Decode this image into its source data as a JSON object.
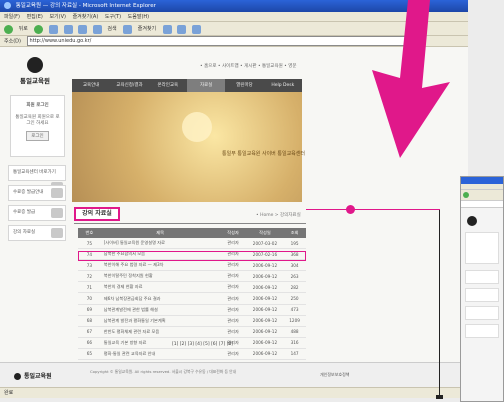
{
  "browser": {
    "title": "통일교육원 — 강의 자료실 - Microsoft Internet Explorer",
    "menu": [
      "파일(F)",
      "편집(E)",
      "보기(V)",
      "즐겨찾기(A)",
      "도구(T)",
      "도움말(H)"
    ],
    "toolbar": [
      "뒤로",
      "검색",
      "즐겨찾기"
    ],
    "address_label": "주소(D)",
    "address_value": "http://www.uniedu.go.kr/",
    "go_label": "이동",
    "status_text": "완료"
  },
  "site": {
    "logo_name": "통일교육원",
    "util_nav": "• 홈으로 • 사이트맵 • 게시판 • 통일교육원 • 영문",
    "gnb": [
      "교육안내",
      "교육신청/결과",
      "온라인교육",
      "자료실",
      "열린마당",
      "Help Desk"
    ],
    "login": {
      "title": "회원 로그인",
      "notice": "통일교육원 회원으로 로그인 하세요",
      "button": "로그인"
    },
    "banner_text": "통일부 통일교육원 사이버 통일교육센터",
    "side_items": [
      "통일교육센터 바로가기",
      "수료증 발급안내",
      "수료증 발급",
      "강의 자료실"
    ]
  },
  "board": {
    "title": "강의 자료실",
    "breadcrumb": "• Home > 강의자료실",
    "columns": [
      "번호",
      "제목",
      "작성자",
      "작성일",
      "조회"
    ],
    "rows": [
      [
        "75",
        "[사이버] 통일교육원 운영설명 자료",
        "관리자",
        "2007-03-02",
        "195"
      ],
      [
        "74",
        "남북한 주요합의서 모음",
        "관리자",
        "2007-02-16",
        "368"
      ],
      [
        "73",
        "북한이해 주요 법령 자료 — 제3차",
        "관리자",
        "2006-09-12",
        "304"
      ],
      [
        "72",
        "북한이탈주민 정착지원 현황",
        "관리자",
        "2006-09-12",
        "263"
      ],
      [
        "71",
        "북한의 경제 현황 자료",
        "관리자",
        "2006-09-12",
        "282"
      ],
      [
        "70",
        "제6차 남북장관급회담 주요 결과",
        "관리자",
        "2006-09-12",
        "250"
      ],
      [
        "69",
        "남북관계발전에 관한 법률 해설",
        "관리자",
        "2006-09-12",
        "473"
      ],
      [
        "68",
        "남북관계 발전과 평화통일 기본계획",
        "관리자",
        "2006-09-12",
        "1209"
      ],
      [
        "67",
        "한반도 평화체제 관련 자료 모음",
        "관리자",
        "2006-09-12",
        "488"
      ],
      [
        "66",
        "통일교육 기본 방향 자료",
        "관리자",
        "2006-09-12",
        "316"
      ],
      [
        "65",
        "평화·통일 관련 교육자료 안내",
        "관리자",
        "2006-09-12",
        "147"
      ],
      [
        "64",
        "통일문제 이해 강의자료",
        "관리자",
        "2006-09-12",
        "265"
      ]
    ],
    "pager": "[1] [2] [3] [4] [5] [6] [7] [8]"
  },
  "footer": {
    "logo_name": "통일교육원",
    "copyright": "Copyright © 통일교육원. All rights reserved. 서울시 강북구 수유동 / 대표전화 등 안내",
    "badge": "개인정보보호정책"
  },
  "colors": {
    "accent": "#e0188a",
    "arrow": "#e0188a",
    "ie_title": "#2b63d8"
  }
}
